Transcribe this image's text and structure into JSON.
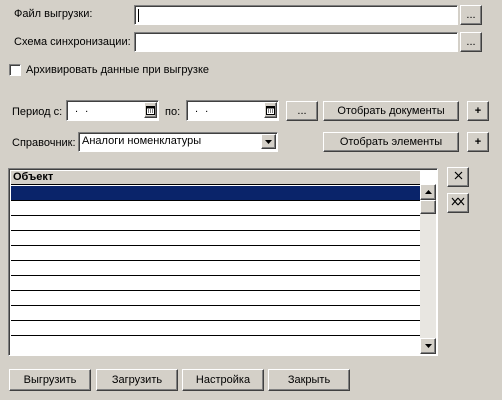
{
  "form": {
    "export_file_label": "Файл выгрузки:",
    "export_file_value": "",
    "sync_scheme_label": "Схема синхронизации:",
    "sync_scheme_value": "",
    "browse_label": "...",
    "archive_checkbox_label": "Архивировать данные при выгрузке",
    "archive_checked": false
  },
  "period": {
    "from_label": "Период с:",
    "from_value": ". .",
    "to_label": "по:",
    "to_value": ". .",
    "choose_label": "...",
    "select_documents_label": "Отобрать документы",
    "add_label": "+"
  },
  "catalog": {
    "label": "Справочник:",
    "selected": "Аналоги номенклатуры",
    "select_elements_label": "Отобрать элементы",
    "add_label": "+"
  },
  "table": {
    "column_header": "Объект",
    "rows": [
      "",
      "",
      "",
      "",
      "",
      "",
      "",
      "",
      "",
      ""
    ],
    "selected_row": 0
  },
  "side_buttons": {
    "delete_icon": "cross-icon",
    "clear_icon": "double-cross-icon"
  },
  "footer": {
    "export_label": "Выгрузить",
    "load_label": "Загрузить",
    "settings_label": "Настройка",
    "close_label": "Закрыть"
  },
  "colors": {
    "background": "#d4d0c8",
    "selection": "#0a246a"
  }
}
